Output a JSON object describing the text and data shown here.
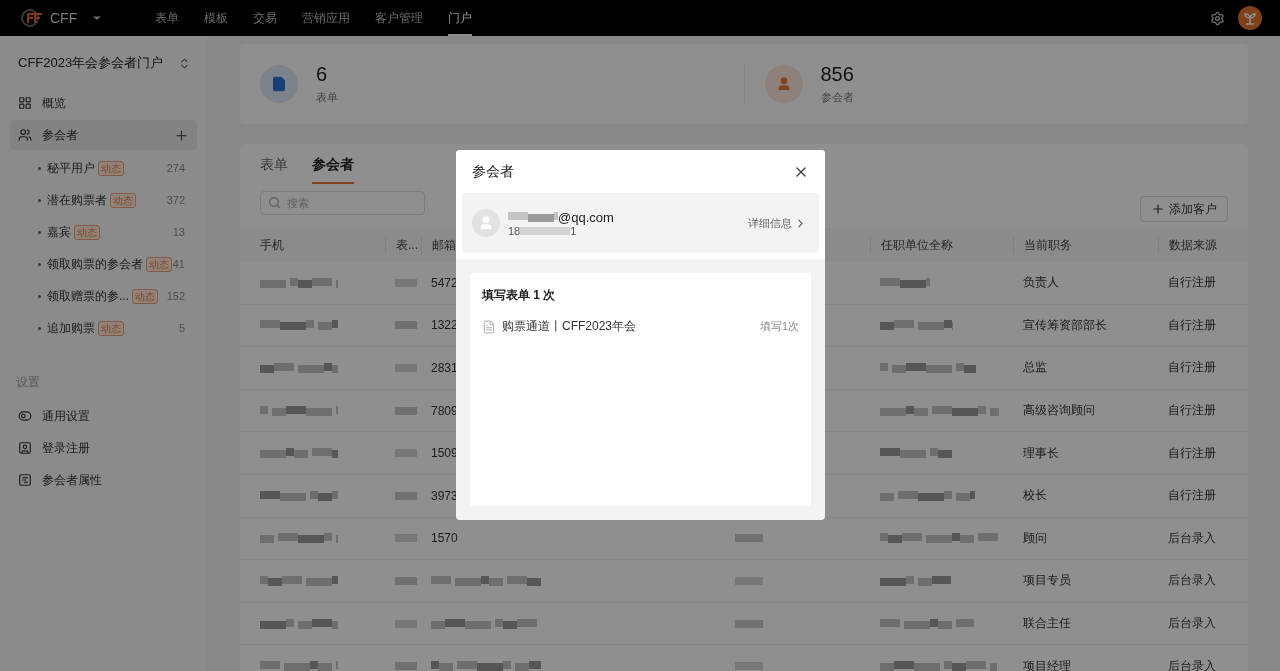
{
  "topbar": {
    "brand": "CFF",
    "nav": [
      {
        "label": "表单",
        "selected": false
      },
      {
        "label": "模板",
        "selected": false
      },
      {
        "label": "交易",
        "selected": false
      },
      {
        "label": "营销应用",
        "selected": false
      },
      {
        "label": "客户管理",
        "selected": false
      },
      {
        "label": "门户",
        "selected": true
      }
    ]
  },
  "sidebar": {
    "title": "CFF2023年会参会者门户",
    "items": [
      {
        "kind": "overview",
        "label": "概览",
        "selected": false
      },
      {
        "kind": "attendees",
        "label": "参会者",
        "selected": true
      }
    ],
    "segments": [
      {
        "label": "秘平用户",
        "tag": "动态",
        "count": "274"
      },
      {
        "label": "潜在购票者",
        "tag": "动态",
        "count": "372"
      },
      {
        "label": "嘉宾",
        "tag": "动态",
        "count": "13"
      },
      {
        "label": "领取购票的参会者",
        "tag": "动态",
        "count": "41"
      },
      {
        "label": "领取赠票的参...",
        "tag": "动态",
        "count": "152"
      },
      {
        "label": "追加购票",
        "tag": "动态",
        "count": "5"
      }
    ],
    "settings_label": "设置",
    "settings": [
      {
        "kind": "toggles",
        "label": "通用设置"
      },
      {
        "kind": "login",
        "label": "登录注册"
      },
      {
        "kind": "text",
        "label": "参会者属性"
      }
    ]
  },
  "stats": [
    {
      "kind": "forms",
      "value": "6",
      "label": "表单"
    },
    {
      "kind": "people",
      "value": "856",
      "label": "参会者"
    }
  ],
  "tabs": [
    {
      "label": "表单",
      "selected": false
    },
    {
      "label": "参会者",
      "selected": true
    }
  ],
  "search": {
    "placeholder": "搜索"
  },
  "add_button": "添加客户",
  "table": {
    "columns": [
      "手机",
      "表...",
      "邮箱",
      "任职单位全称",
      "当前职务",
      "数据来源"
    ],
    "rows": [
      {
        "email": "5472",
        "title": "负责人",
        "source": "自行注册"
      },
      {
        "email": "1322",
        "title": "宣传筹资部部长",
        "source": "自行注册"
      },
      {
        "email": "2831",
        "title": "总监",
        "source": "自行注册"
      },
      {
        "email": "7809",
        "title": "高级咨询顾问",
        "source": "自行注册"
      },
      {
        "email": "1509",
        "title": "理事长",
        "source": "自行注册"
      },
      {
        "email": "3973",
        "title": "校长",
        "source": "自行注册"
      },
      {
        "email": "1570",
        "title": "顾问",
        "source": "后台录入"
      },
      {
        "title": "项目专员",
        "source": "后台录入"
      },
      {
        "title": "联合主任",
        "source": "后台录入"
      },
      {
        "title": "项目经理",
        "source": "后台录入"
      }
    ]
  },
  "modal": {
    "title": "参会者",
    "email": "@qq.com",
    "phone_start": "18",
    "phone_end": "1",
    "details": "详细信息",
    "section_title": "填写表单 1 次",
    "forms": [
      {
        "name": "购票通道丨CFF2023年会",
        "count": "填写1次"
      }
    ]
  }
}
